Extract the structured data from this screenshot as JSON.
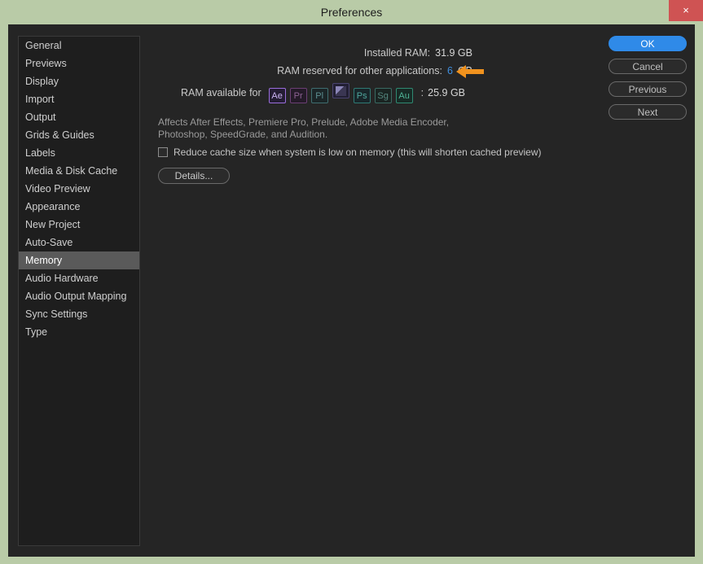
{
  "window": {
    "title": "Preferences",
    "close_label": "×",
    "titlebar_color": "#b9cba7",
    "close_color": "#cf5353"
  },
  "sidebar": {
    "items": [
      {
        "label": "General",
        "selected": false
      },
      {
        "label": "Previews",
        "selected": false
      },
      {
        "label": "Display",
        "selected": false
      },
      {
        "label": "Import",
        "selected": false
      },
      {
        "label": "Output",
        "selected": false
      },
      {
        "label": "Grids & Guides",
        "selected": false
      },
      {
        "label": "Labels",
        "selected": false
      },
      {
        "label": "Media & Disk Cache",
        "selected": false
      },
      {
        "label": "Video Preview",
        "selected": false
      },
      {
        "label": "Appearance",
        "selected": false
      },
      {
        "label": "New Project",
        "selected": false
      },
      {
        "label": "Auto-Save",
        "selected": false
      },
      {
        "label": "Memory",
        "selected": true
      },
      {
        "label": "Audio Hardware",
        "selected": false
      },
      {
        "label": "Audio Output Mapping",
        "selected": false
      },
      {
        "label": "Sync Settings",
        "selected": false
      },
      {
        "label": "Type",
        "selected": false
      }
    ]
  },
  "memory": {
    "installed_ram_label": "Installed RAM:",
    "installed_ram_value": "31.9 GB",
    "reserved_label": "RAM reserved for other applications:",
    "reserved_value": "6",
    "reserved_unit": "GB",
    "reserved_value_color": "#3f8fe0",
    "annotation_arrow": "left-arrow",
    "annotation_color": "#f0921e",
    "available_label": "RAM available for",
    "available_separator": ":",
    "available_value": "25.9 GB",
    "apps": [
      {
        "code": "Ae",
        "name": "after-effects",
        "style": "ae"
      },
      {
        "code": "Pr",
        "name": "premiere-pro",
        "style": "pr"
      },
      {
        "code": "Pl",
        "name": "prelude",
        "style": "pl"
      },
      {
        "code": "",
        "name": "adobe-media-encoder",
        "style": "ame"
      },
      {
        "code": "Ps",
        "name": "photoshop",
        "style": "ps"
      },
      {
        "code": "Sg",
        "name": "speedgrade",
        "style": "sg"
      },
      {
        "code": "Au",
        "name": "audition",
        "style": "au"
      }
    ],
    "affects_text": "Affects After Effects, Premiere Pro, Prelude, Adobe Media Encoder, Photoshop, SpeedGrade, and Audition.",
    "reduce_cache_label": "Reduce cache size when system is low on memory (this will shorten cached preview)",
    "reduce_cache_checked": false,
    "details_label": "Details..."
  },
  "actions": {
    "buttons": [
      {
        "label": "OK",
        "primary": true
      },
      {
        "label": "Cancel",
        "primary": false
      },
      {
        "label": "Previous",
        "primary": false
      },
      {
        "label": "Next",
        "primary": false
      }
    ],
    "primary_color": "#2f8ae8"
  }
}
